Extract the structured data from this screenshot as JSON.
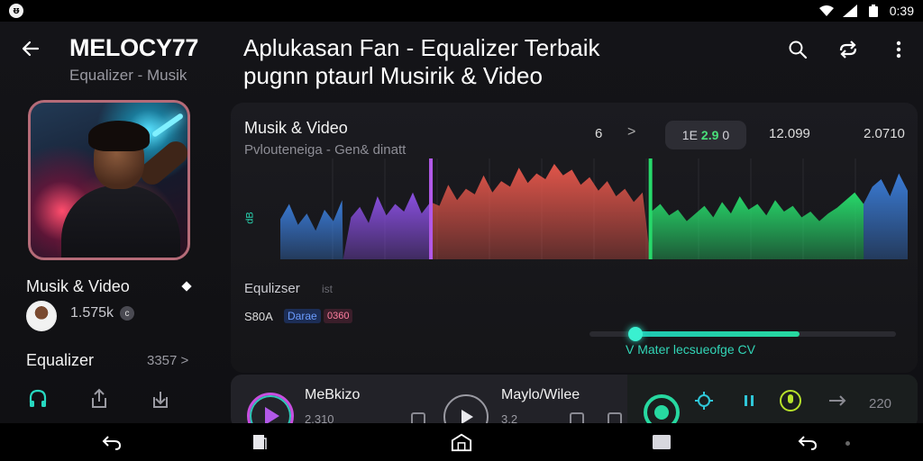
{
  "status_bar": {
    "app_glyph": "ᵿ",
    "time": "0:39",
    "icons": [
      "wifi-icon",
      "signal-icon",
      "battery-icon"
    ]
  },
  "left_panel": {
    "app_title": "MELOCY77",
    "app_subtitle": "Equalizer - Musik",
    "track_title": "Musik & Video",
    "listen_count": "1.575k",
    "count_badge": "c",
    "eq_title": "Equalizer",
    "eq_count": "3357 >"
  },
  "header": {
    "headline_line1": "Aplukasan Fan - Equalizer Terbaik",
    "headline_line2": "pugnn ptaurl Musirik & Video"
  },
  "eq_panel": {
    "title": "Musik & Video",
    "subtitle": "Pvlouteneiga - Gen& dinatt",
    "band_number": "6",
    "band_next": ">",
    "pill_prefix": "1E",
    "pill_value": "2.9",
    "pill_suffix": "0",
    "stat1": "12.099",
    "stat2": "2.0710",
    "y_axis_label": "dB",
    "label": "Equlizser",
    "label_hint": "ist",
    "preset_name": "S80A",
    "tag_a": "Darae",
    "tag_b": "0360",
    "slider_caption": "V  Mater lecsueofge CV",
    "slider_value": 0.15
  },
  "player": {
    "title1": "MeBkizo",
    "time1": "2.310",
    "title2": "Maylo/Wilee",
    "time2": "3.2",
    "end_value": "220"
  },
  "chart_data": {
    "type": "area",
    "title": "",
    "xlabel": "",
    "ylabel": "dB",
    "segments": [
      {
        "color": "#3a7bd5",
        "range": [
          0,
          0.1
        ]
      },
      {
        "color": "#8a4fe0",
        "range": [
          0.1,
          0.24
        ]
      },
      {
        "color": "#e0554a",
        "range": [
          0.24,
          0.59
        ]
      },
      {
        "color": "#27d86a",
        "range": [
          0.59,
          0.93
        ]
      },
      {
        "color": "#3a7bd5",
        "range": [
          0.93,
          1
        ]
      }
    ],
    "values": [
      42,
      58,
      36,
      48,
      30,
      52,
      40,
      62,
      44,
      55,
      38,
      66,
      46,
      58,
      50,
      70,
      48,
      60,
      56,
      78,
      62,
      74,
      68,
      88,
      70,
      82,
      76,
      96,
      80,
      90,
      84,
      100,
      88,
      94,
      78,
      86,
      72,
      82,
      66,
      74,
      60,
      70,
      50,
      58,
      46,
      52,
      40,
      48,
      56,
      44,
      60,
      48,
      66,
      52,
      58,
      46,
      62,
      50,
      56,
      44,
      50,
      40,
      48,
      54,
      62,
      70,
      58,
      76,
      84,
      66,
      90,
      72
    ],
    "markers": [
      {
        "label": "violet-marker",
        "color": "#b259e8",
        "position": 0.24
      },
      {
        "label": "green-marker",
        "color": "#27d86a",
        "position": 0.59
      }
    ],
    "grid": true
  }
}
